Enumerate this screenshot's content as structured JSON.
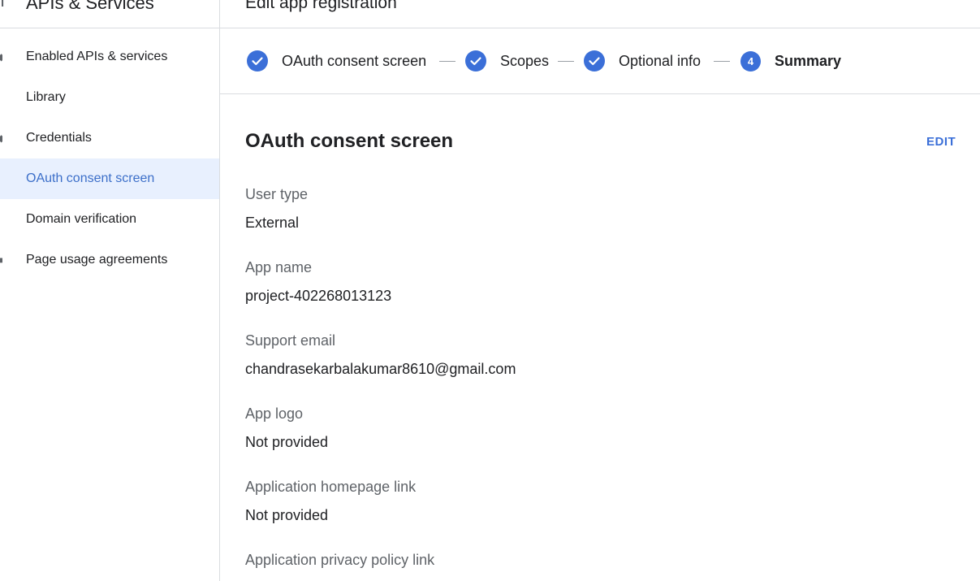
{
  "sidebar": {
    "product_title": "APIs & Services",
    "items": [
      {
        "label": "Enabled APIs & services",
        "active": false
      },
      {
        "label": "Library",
        "active": false
      },
      {
        "label": "Credentials",
        "active": false
      },
      {
        "label": "OAuth consent screen",
        "active": true
      },
      {
        "label": "Domain verification",
        "active": false
      },
      {
        "label": "Page usage agreements",
        "active": false
      }
    ]
  },
  "header": {
    "title": "Edit app registration"
  },
  "stepper": {
    "steps": [
      {
        "label": "OAuth consent screen",
        "state": "complete"
      },
      {
        "label": "Scopes",
        "state": "complete"
      },
      {
        "label": "Optional info",
        "state": "complete"
      },
      {
        "label": "Summary",
        "state": "current",
        "number": "4"
      }
    ]
  },
  "summary": {
    "section_title": "OAuth consent screen",
    "edit_label": "EDIT",
    "fields": [
      {
        "label": "User type",
        "value": "External"
      },
      {
        "label": "App name",
        "value": "project-402268013123"
      },
      {
        "label": "Support email",
        "value": "chandrasekarbalakumar8610@gmail.com"
      },
      {
        "label": "App logo",
        "value": "Not provided"
      },
      {
        "label": "Application homepage link",
        "value": "Not provided"
      },
      {
        "label": "Application privacy policy link",
        "value": ""
      }
    ]
  },
  "colors": {
    "accent": "#3b6fd8",
    "active_bg": "#e8f0fe",
    "divider": "#dadce0",
    "muted_text": "#5f6368"
  }
}
